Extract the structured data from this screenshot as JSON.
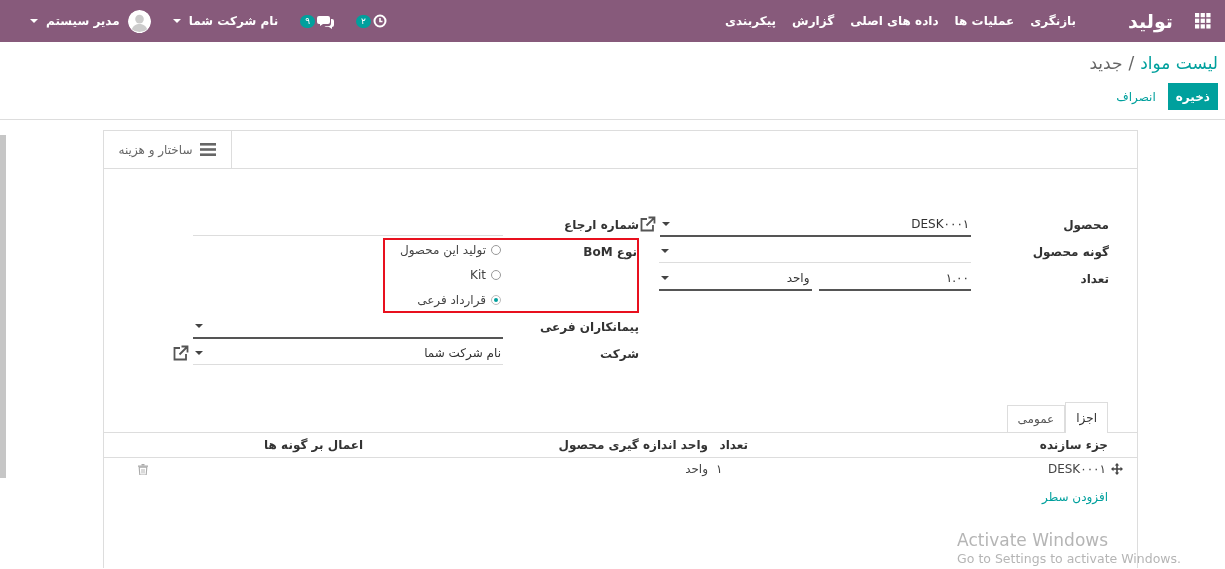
{
  "navbar": {
    "app_name": "تولید",
    "menu": [
      "بازنگری",
      "عملیات ها",
      "داده های اصلی",
      "گزارش",
      "پیکربندی"
    ],
    "activity_count": "۲",
    "message_count": "۹",
    "company": "نام شرکت شما",
    "user": "مدیر سیستم"
  },
  "breadcrumb": {
    "parent": "لیست مواد",
    "separator": "/",
    "current": "جدید"
  },
  "actions": [
    {
      "label": "ذخیره",
      "kind": "primary"
    },
    {
      "label": "انصراف",
      "kind": "link"
    }
  ],
  "button_box": [
    {
      "label": "ساختار و هزینه"
    }
  ],
  "fields_right": [
    {
      "label": "محصول",
      "kind": "select",
      "value": "DESK۰۰۰۱",
      "required": true,
      "external_link": true
    },
    {
      "label": "گونه محصول",
      "kind": "select",
      "required": false,
      "external_link": false
    },
    {
      "label": "تعداد",
      "kind": "quantity",
      "value": "۱.۰۰",
      "unit": "واحد",
      "required": true,
      "external_link": false
    }
  ],
  "fields_left": [
    {
      "label": "شماره ارجاع",
      "kind": "text",
      "required": false,
      "external_link": false
    },
    {
      "label": "نوع BoM",
      "kind": "radio",
      "highlighted": true,
      "options": [
        {
          "label": "تولید این محصول",
          "selected": false
        },
        {
          "label": "Kit",
          "selected": false
        },
        {
          "label": "قرارداد فرعی",
          "selected": true
        }
      ]
    },
    {
      "label": "پیمانکاران فرعی",
      "kind": "select",
      "required": true,
      "external_link": false
    },
    {
      "label": "شرکت",
      "kind": "select",
      "value": "نام شرکت شما",
      "required": false,
      "external_link": true
    }
  ],
  "tabs": [
    {
      "label": "اجزا",
      "selected": true
    },
    {
      "label": "عمومی",
      "selected": false
    }
  ],
  "table": {
    "columns": [
      "جزء سازنده",
      "تعداد",
      "واحد اندازه گیری محصول",
      "اعمال بر گونه ها"
    ],
    "rows": [
      {
        "component": "DESK۰۰۰۱",
        "quantity": "۱",
        "uom": "واحد"
      }
    ],
    "add_line": "افزودن سطر"
  },
  "os_notice": {
    "title": "Activate Windows",
    "subtitle": "Go to Settings to activate Windows."
  }
}
